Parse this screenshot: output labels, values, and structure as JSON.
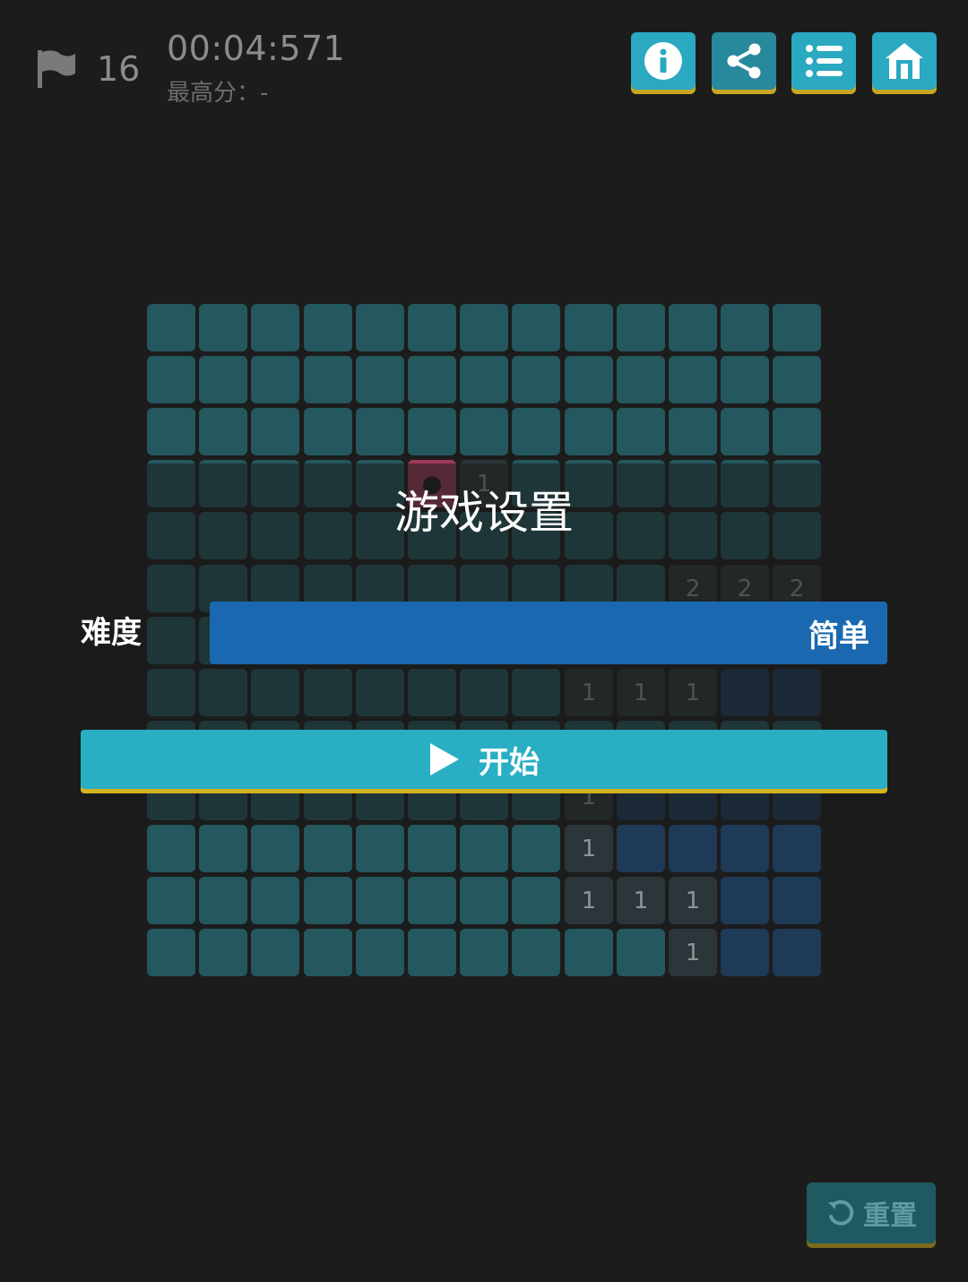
{
  "status": {
    "flags_remaining": "16",
    "timer": "00:04:571",
    "best_score": "最高分：-"
  },
  "toolbar": {
    "info_icon": "info-icon",
    "share_icon": "share-icon",
    "list_icon": "list-icon",
    "home_icon": "home-icon"
  },
  "board": {
    "rows": 13,
    "cols": 13,
    "grid": [
      "HHHHHHHHHHHHH",
      "HHHHHHHHHHHHH",
      "HHHHHHHHHHHHH",
      "HHHHHM1HHHHHH",
      "HHHHHHHHHHHHH",
      "HHHHHHHHHH222",
      "HHHHHHHHHHHHH",
      "HHHHHHHH111EE",
      "HHHHHHHHHHHHH",
      "HHHHHHHH1EEEE",
      "HHHHHHHH1EEEE",
      "HHHHHHHH111EE",
      "HHHHHHHHHH1EE"
    ],
    "colors": {
      "hidden": "#24575e",
      "open": "#2c3539",
      "empty": "#1e3a57",
      "mine": "#a03a5a"
    }
  },
  "dialog": {
    "title": "游戏设置",
    "difficulty_label": "难度",
    "difficulty_value": "简单",
    "start_label": "开始"
  },
  "reset": {
    "label": "重置"
  },
  "colors": {
    "background": "#1c1c1c",
    "accent": "#2aa9c0",
    "button_shadow": "#c9a623",
    "select": "#1a69b0"
  }
}
